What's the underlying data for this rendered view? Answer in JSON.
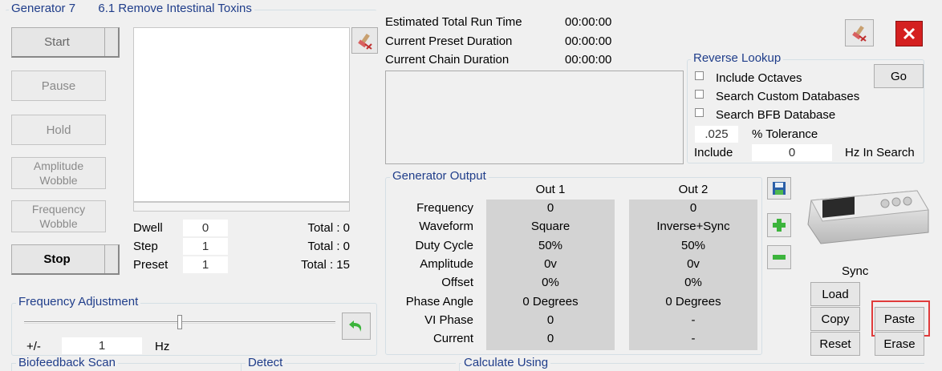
{
  "header": {
    "generator": "Generator 7",
    "preset_name": "6.1 Remove Intestinal Toxins"
  },
  "controls": {
    "start": "Start",
    "pause": "Pause",
    "hold": "Hold",
    "amplitude_wobble": "Amplitude\nWobble",
    "frequency_wobble": "Frequency\nWobble",
    "stop": "Stop"
  },
  "counters": {
    "dwell_label": "Dwell",
    "dwell_value": "0",
    "dwell_total": "Total : 0",
    "step_label": "Step",
    "step_value": "1",
    "step_total": "Total : 0",
    "preset_label": "Preset",
    "preset_value": "1",
    "preset_total": "Total : 15"
  },
  "timing": {
    "estimated_label": "Estimated Total Run Time",
    "estimated_value": "00:00:00",
    "preset_label": "Current Preset Duration",
    "preset_value": "00:00:00",
    "chain_label": "Current Chain Duration",
    "chain_value": "00:00:00"
  },
  "reverse_lookup": {
    "title": "Reverse Lookup",
    "include_octaves": "Include Octaves",
    "search_custom": "Search Custom Databases",
    "search_bfb": "Search BFB Database",
    "go": "Go",
    "tolerance_value": ".025",
    "tolerance_label": "% Tolerance",
    "include_label": "Include",
    "include_value": "0",
    "hz_label": "Hz In Search"
  },
  "generator_output": {
    "title": "Generator Output",
    "col1": "Out 1",
    "col2": "Out 2",
    "rows": [
      {
        "label": "Frequency",
        "out1": "0",
        "out2": "0"
      },
      {
        "label": "Waveform",
        "out1": "Square",
        "out2": "Inverse+Sync"
      },
      {
        "label": "Duty Cycle",
        "out1": "50%",
        "out2": "50%"
      },
      {
        "label": "Amplitude",
        "out1": "0v",
        "out2": "0v"
      },
      {
        "label": "Offset",
        "out1": "0%",
        "out2": "0%"
      },
      {
        "label": "Phase Angle",
        "out1": "0 Degrees",
        "out2": "0 Degrees"
      },
      {
        "label": "VI Phase",
        "out1": "0",
        "out2": "-"
      },
      {
        "label": "Current",
        "out1": "0",
        "out2": "-"
      }
    ]
  },
  "frequency_adjustment": {
    "title": "Frequency Adjustment",
    "slider_level": 0.5,
    "plusminus_label": "+/-",
    "plusminus_value": "1",
    "unit": "Hz"
  },
  "sync": {
    "title": "Sync",
    "load": "Load",
    "copy": "Copy",
    "paste": "Paste",
    "reset": "Reset",
    "erase": "Erase"
  },
  "bottom_groups": {
    "biofeedback": "Biofeedback Scan",
    "detect": "Detect",
    "calculate": "Calculate Using"
  },
  "colors": {
    "group_title": "#1f3d8a",
    "highlight": "#e03b3b",
    "close_button": "#d42020"
  }
}
